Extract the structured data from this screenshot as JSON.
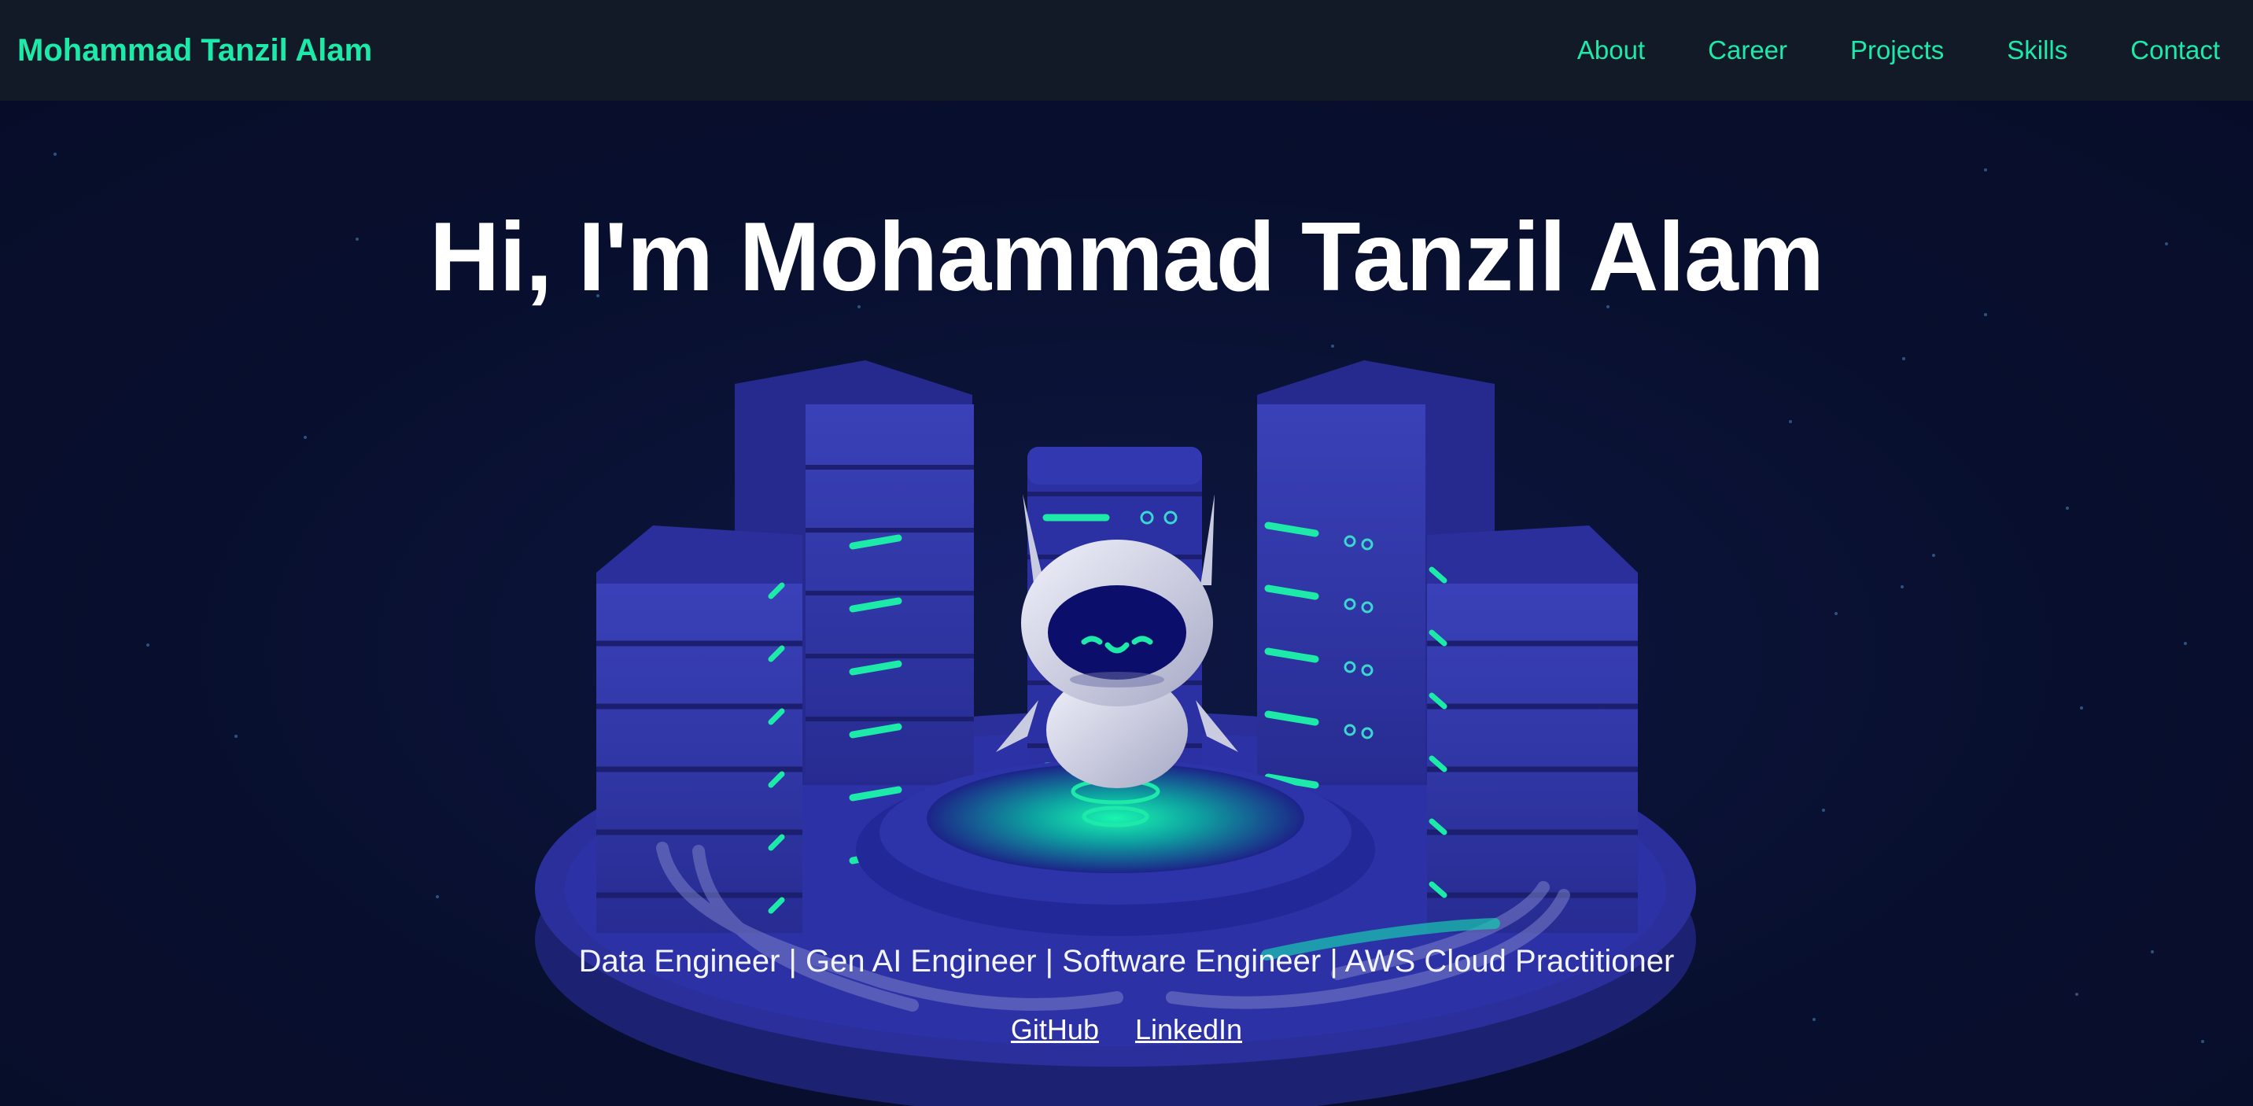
{
  "nav": {
    "brand": "Mohammad Tanzil Alam",
    "links": [
      "About",
      "Career",
      "Projects",
      "Skills",
      "Contact"
    ]
  },
  "hero": {
    "title": "Hi, I'm Mohammad Tanzil Alam",
    "subtitle": "Data Engineer | Gen AI Engineer | Software Engineer | AWS Cloud Practitioner",
    "links": [
      "GitHub",
      "LinkedIn"
    ],
    "illustration": "robot-with-server-racks-illustration"
  },
  "colors": {
    "accent": "#1de9a8",
    "navbar_bg": "#121927",
    "page_bg": "#080f2e",
    "server_blue": "#2a2f9a"
  }
}
